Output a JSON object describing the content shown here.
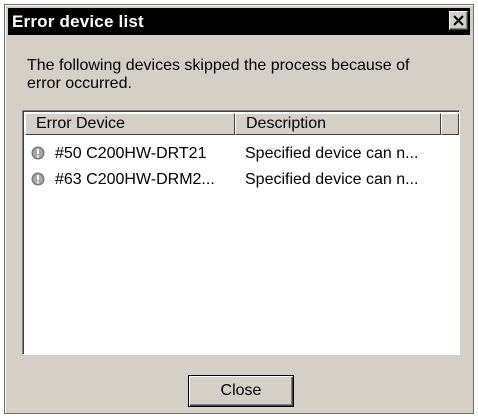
{
  "window": {
    "title": "Error device list"
  },
  "message": "The following devices skipped the process because of error occurred.",
  "list": {
    "columns": [
      "Error Device",
      "Description",
      ""
    ],
    "rows": [
      {
        "icon": "error-icon",
        "device": "#50 C200HW-DRT21",
        "description": "Specified device can n..."
      },
      {
        "icon": "error-icon",
        "device": "#63 C200HW-DRM2...",
        "description": "Specified device can n..."
      }
    ]
  },
  "buttons": {
    "close_label": "Close"
  },
  "colors": {
    "titlebar": "#000000",
    "face": "#d4d0c8",
    "list_background": "#ffffff"
  }
}
